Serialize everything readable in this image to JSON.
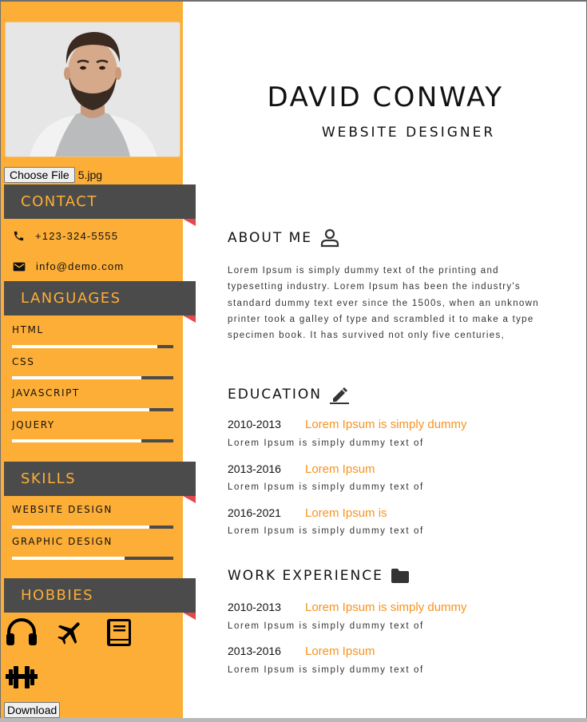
{
  "colors": {
    "accent": "#fdae36",
    "dark": "#4b4b4b",
    "highlight": "#f7931e",
    "corner": "#e4474c"
  },
  "profile": {
    "photo_alt": "profile photo",
    "file_button": "Choose File",
    "file_name": "5.jpg",
    "name": "DAVID CONWAY",
    "title": "WEBSITE DESIGNER"
  },
  "contact": {
    "heading": "CONTACT",
    "phone": "+123-324-5555",
    "email": "info@demo.com"
  },
  "languages": {
    "heading": "LANGUAGES",
    "items": [
      {
        "name": "HTML",
        "level": 0.9
      },
      {
        "name": "CSS",
        "level": 0.8
      },
      {
        "name": "JAVASCRIPT",
        "level": 0.85
      },
      {
        "name": "JQUERY",
        "level": 0.8
      }
    ]
  },
  "skills": {
    "heading": "SKILLS",
    "items": [
      {
        "name": "WEBSITE DESIGN",
        "level": 0.85
      },
      {
        "name": "GRAPHIC DESIGN",
        "level": 0.7
      }
    ]
  },
  "hobbies": {
    "heading": "HOBBIES",
    "icons": [
      "headphones-icon",
      "airplane-icon",
      "book-icon",
      "dumbbell-icon"
    ]
  },
  "download_button": "Download",
  "about": {
    "heading": "ABOUT ME",
    "text": "Lorem Ipsum is simply dummy text of the printing and typesetting industry. Lorem Ipsum has been the industry's standard dummy text ever since the 1500s, when an unknown printer took a galley of type and scrambled it to make a type specimen book. It has survived not only five centuries,"
  },
  "education": {
    "heading": "EDUCATION",
    "entries": [
      {
        "year": "2010-2013",
        "title": "Lorem Ipsum is simply dummy",
        "desc": "Lorem Ipsum is simply dummy text of"
      },
      {
        "year": "2013-2016",
        "title": "Lorem Ipsum",
        "desc": "Lorem Ipsum is simply dummy text of"
      },
      {
        "year": "2016-2021",
        "title": "Lorem Ipsum is",
        "desc": "Lorem Ipsum is simply dummy text of"
      }
    ]
  },
  "experience": {
    "heading": "WORK EXPERIENCE",
    "entries": [
      {
        "year": "2010-2013",
        "title": "Lorem Ipsum is simply dummy",
        "desc": "Lorem Ipsum is simply dummy text of"
      },
      {
        "year": "2013-2016",
        "title": "Lorem Ipsum",
        "desc": "Lorem Ipsum is simply dummy text of"
      }
    ]
  }
}
